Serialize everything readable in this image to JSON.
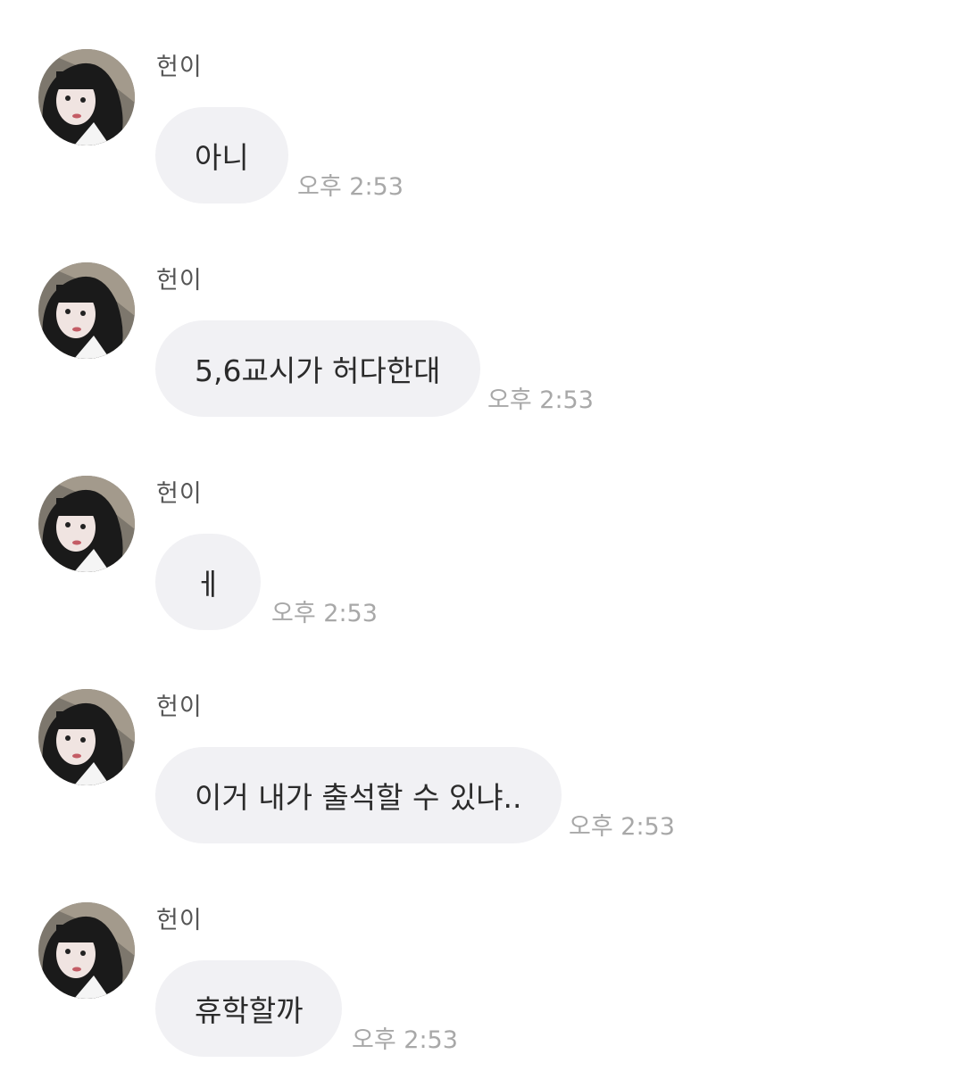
{
  "messages": [
    {
      "sender": "헌이",
      "text": "아니",
      "time": "오후 2:53"
    },
    {
      "sender": "헌이",
      "text": "5,6교시가 허다한대",
      "time": "오후 2:53"
    },
    {
      "sender": "헌이",
      "text": "ㅔ",
      "time": "오후 2:53"
    },
    {
      "sender": "헌이",
      "text": "이거 내가 출석할 수 있냐..",
      "time": "오후 2:53"
    },
    {
      "sender": "헌이",
      "text": "휴학할까",
      "time": "오후 2:53"
    }
  ]
}
